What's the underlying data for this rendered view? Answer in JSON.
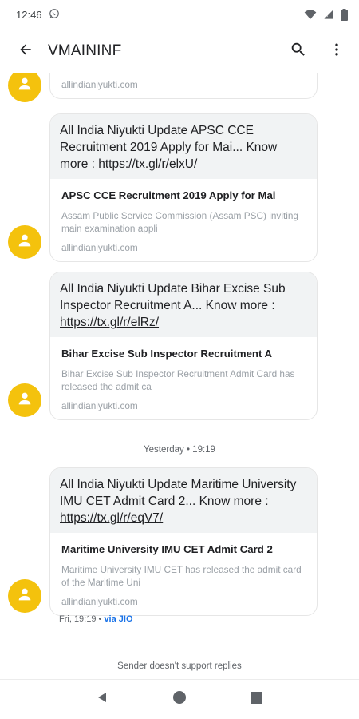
{
  "status_bar": {
    "time": "12:46"
  },
  "app_bar": {
    "title": "VMAININF"
  },
  "messages": [
    {
      "preview_domain": "allindianiyukti.com"
    },
    {
      "text_prefix": "All India Niyukti Update APSC CCE Recruitment 2019 Apply for Mai... Know more : ",
      "link": "https://tx.gl/r/elxU/",
      "preview_title": "APSC CCE Recruitment 2019 Apply for Mai",
      "preview_desc": "Assam Public Service Commission (Assam PSC) inviting main examination appli",
      "preview_domain": "allindianiyukti.com"
    },
    {
      "text_prefix": "All India Niyukti Update Bihar Excise Sub Inspector Recruitment A... Know more : ",
      "link": "https://tx.gl/r/elRz/",
      "preview_title": "Bihar Excise Sub Inspector Recruitment A",
      "preview_desc": "Bihar Excise Sub Inspector Recruitment Admit Card has released the admit ca",
      "preview_domain": "allindianiyukti.com"
    },
    {
      "text_prefix": "All India Niyukti Update Maritime University IMU CET Admit Card 2... Know more : ",
      "link": "https://tx.gl/r/eqV7/",
      "preview_title": "Maritime University IMU CET Admit Card 2",
      "preview_desc": "Maritime University IMU CET has released the admit card of the Maritime Uni",
      "preview_domain": "allindianiyukti.com"
    }
  ],
  "divider": "Yesterday • 19:19",
  "last_meta": {
    "time": "Fri, 19:19 • ",
    "via": "via JIO"
  },
  "footer_note": "Sender doesn't support replies",
  "colors": {
    "avatar": "#f4c20d",
    "bubble_bg": "#f1f3f4",
    "link_accent": "#1a73e8"
  },
  "icons": [
    "whatsapp-icon",
    "wifi-icon",
    "signal-icon",
    "battery-icon",
    "back-arrow-icon",
    "search-icon",
    "more-vert-icon",
    "person-icon",
    "nav-back-icon",
    "nav-home-icon",
    "nav-recents-icon"
  ]
}
